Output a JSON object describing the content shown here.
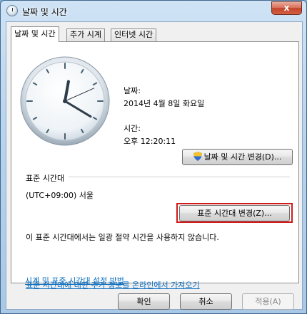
{
  "window": {
    "title": "날짜 및 시간",
    "close_label": "x"
  },
  "tabs": [
    {
      "label": "날짜 및 시간"
    },
    {
      "label": "추가 시계"
    },
    {
      "label": "인터넷 시간"
    }
  ],
  "clock": {
    "hour": 12,
    "minute": 20,
    "second": 11
  },
  "date_section": {
    "date_label": "날짜:",
    "date_value": "2014년 4월 8일 화요일",
    "time_label": "시간:",
    "time_value": "오후 12:20:11",
    "change_datetime_button": "날짜 및 시간 변경(D)..."
  },
  "timezone_section": {
    "heading": "표준 시간대",
    "value": "(UTC+09:00) 서울",
    "change_timezone_button": "표준 시간대 변경(Z)...",
    "dst_note": "이 표준 시간대에서는 일광 절약 시간을 사용하지 않습니다."
  },
  "links": {
    "online_info": "표준 시간대에 대한 추가 정보를 온라인에서 가져오기",
    "settings_help": "시계 및 표준 시간대 설정 방법"
  },
  "footer": {
    "ok": "확인",
    "cancel": "취소",
    "apply": "적용(A)"
  },
  "colors": {
    "highlight": "#d11b1b",
    "link": "#0b6fc2"
  }
}
